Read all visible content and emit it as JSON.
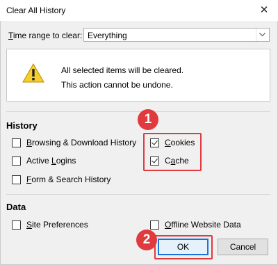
{
  "window": {
    "title": "Clear All History",
    "close_glyph": "✕"
  },
  "time_range": {
    "label_prefix": "T",
    "label_rest": "ime range to clear:",
    "selected": "Everything"
  },
  "warning": {
    "icon": "warning-icon",
    "line1": "All selected items will be cleared.",
    "line2": "This action cannot be undone."
  },
  "history": {
    "heading": "History",
    "items": [
      {
        "pre": "",
        "u": "B",
        "post": "rowsing & Download History",
        "checked": false
      },
      {
        "pre": "Active ",
        "u": "L",
        "post": "ogins",
        "checked": false
      },
      {
        "pre": "",
        "u": "F",
        "post": "orm & Search History",
        "checked": false
      },
      {
        "pre": "",
        "u": "C",
        "post": "ookies",
        "checked": true
      },
      {
        "pre": "C",
        "u": "a",
        "post": "che",
        "checked": true
      }
    ]
  },
  "data": {
    "heading": "Data",
    "items": [
      {
        "pre": "",
        "u": "S",
        "post": "ite Preferences",
        "checked": false
      },
      {
        "pre": "",
        "u": "O",
        "post": "ffline Website Data",
        "checked": false
      }
    ]
  },
  "badges": {
    "one": "1",
    "two": "2"
  },
  "buttons": {
    "ok": "OK",
    "cancel": "Cancel"
  },
  "colors": {
    "highlight": "#e0393e",
    "focus": "#1a73d8"
  }
}
